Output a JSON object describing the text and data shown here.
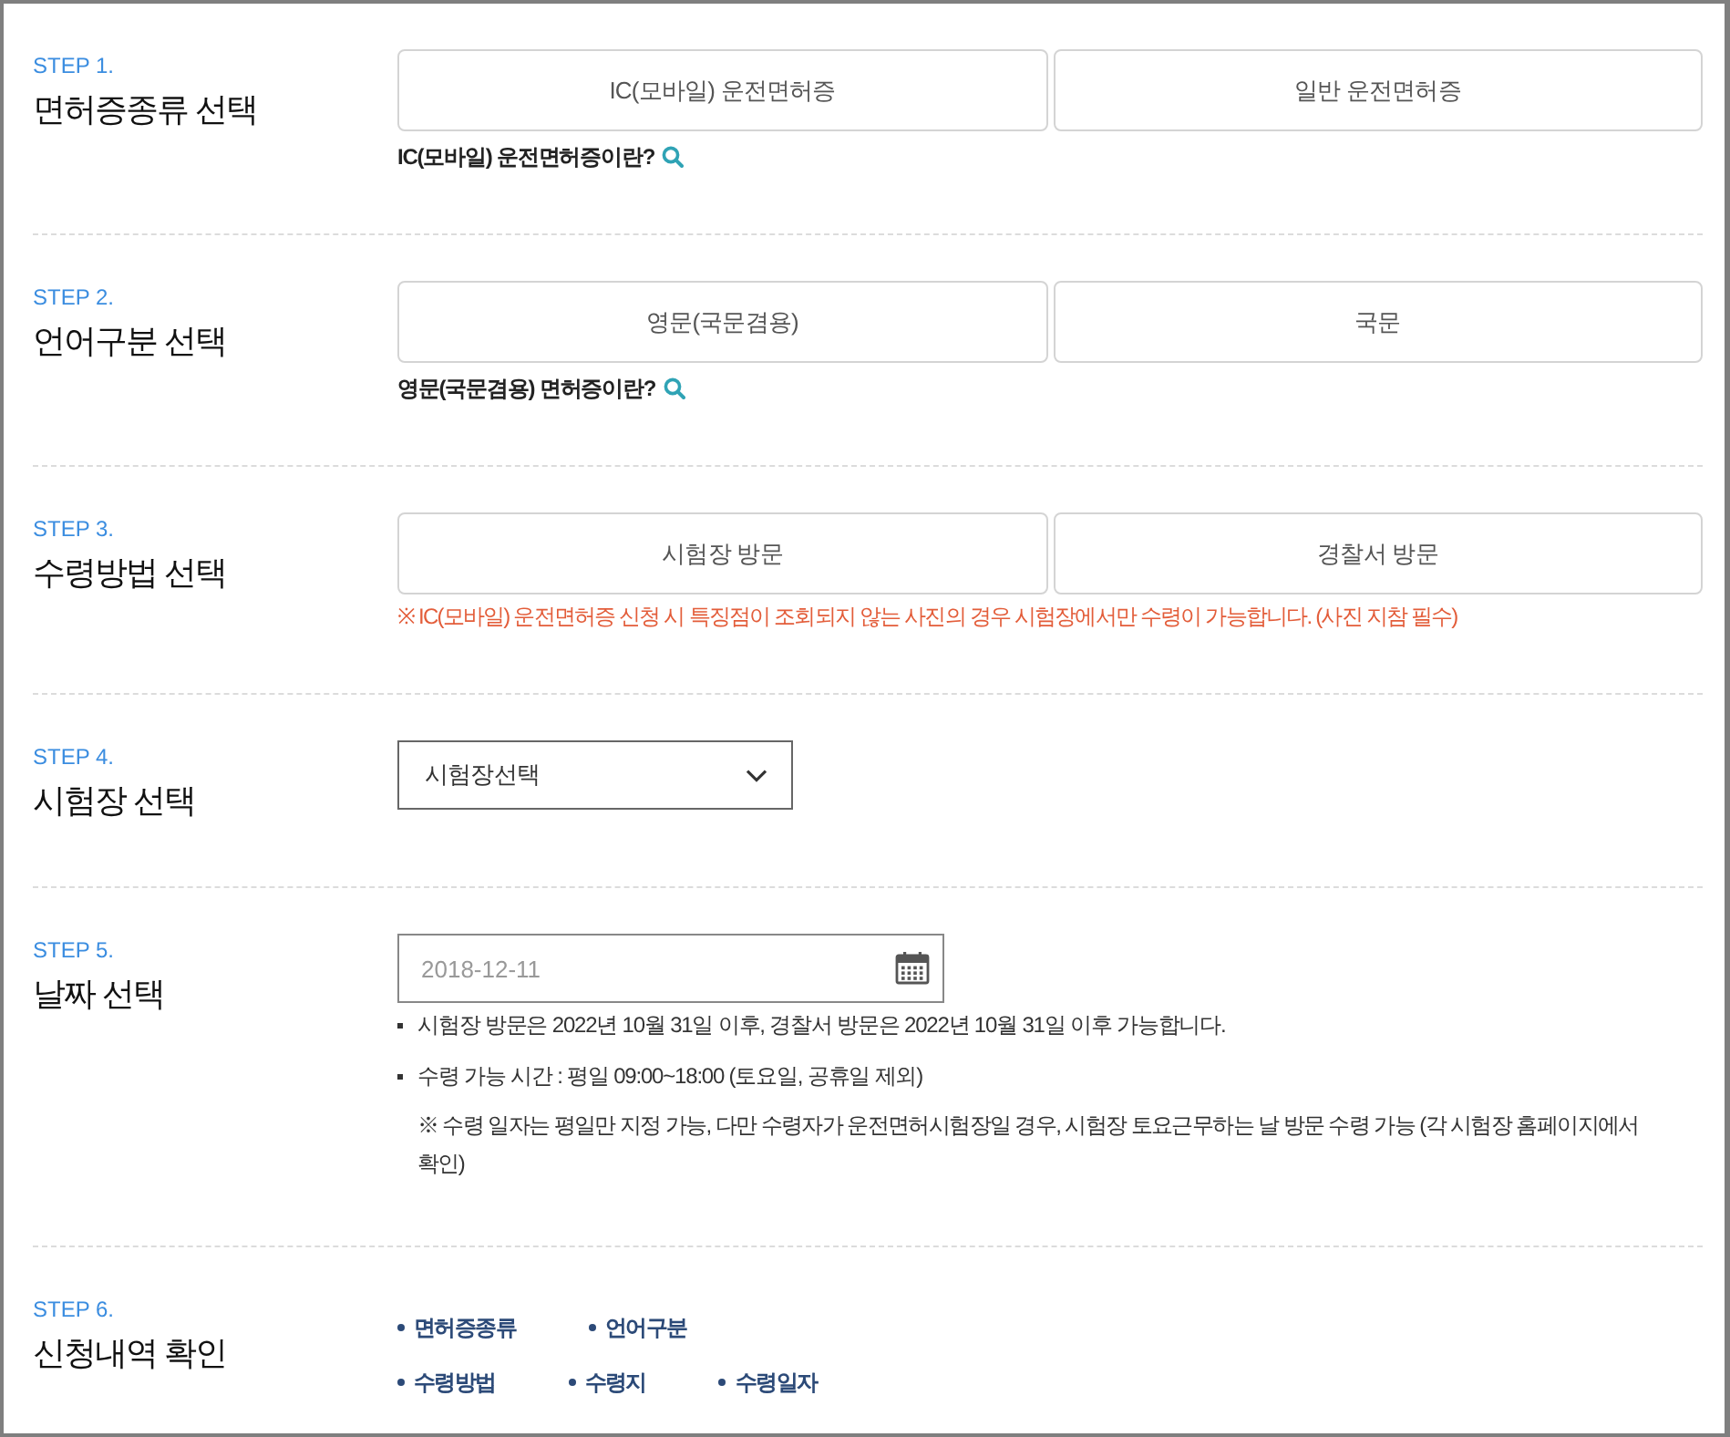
{
  "steps": [
    {
      "kind": "choice",
      "step": "STEP 1.",
      "title": "면허증종류 선택",
      "options": [
        {
          "label": "IC(모바일) 운전면허증",
          "selected": false
        },
        {
          "label": "일반 운전면허증",
          "selected": false
        }
      ],
      "help_link": "IC(모바일) 운전면허증이란?"
    },
    {
      "kind": "choice",
      "step": "STEP 2.",
      "title": "언어구분 선택",
      "options": [
        {
          "label": "영문(국문겸용)",
          "selected": false
        },
        {
          "label": "국문",
          "selected": false
        }
      ],
      "help_link": "영문(국문겸용) 면허증이란?"
    },
    {
      "kind": "choice",
      "step": "STEP 3.",
      "title": "수령방법 선택",
      "options": [
        {
          "label": "시험장 방문",
          "selected": false
        },
        {
          "label": "경찰서 방문",
          "selected": false
        }
      ],
      "warning": "※ IC(모바일) 운전면허증 신청 시 특징점이 조회되지 않는 사진의 경우 시험장에서만 수령이 가능합니다. (사진 지참 필수)"
    },
    {
      "kind": "select",
      "step": "STEP 4.",
      "title": "시험장 선택",
      "select": {
        "value": "시험장선택"
      }
    },
    {
      "kind": "date",
      "step": "STEP 5.",
      "title": "날짜 선택",
      "date": {
        "placeholder": "2018-12-11"
      },
      "notes": [
        "시험장 방문은 2022년 10월 31일 이후, 경찰서 방문은 2022년 10월 31일 이후 가능합니다.",
        "수령 가능 시간 : 평일 09:00~18:00 (토요일, 공휴일 제외)"
      ],
      "remark": "※ 수령 일자는 평일만 지정 가능, 다만 수령자가 운전면허시험장일 경우, 시험장 토요근무하는 날 방문 수령 가능 (각 시험장 홈페이지에서 확인)"
    },
    {
      "kind": "summary",
      "step": "STEP 6.",
      "title": "신청내역 확인",
      "rows": [
        [
          "면허증종류",
          "언어구분"
        ],
        [
          "수령방법",
          "수령지",
          "수령일자"
        ]
      ]
    }
  ]
}
